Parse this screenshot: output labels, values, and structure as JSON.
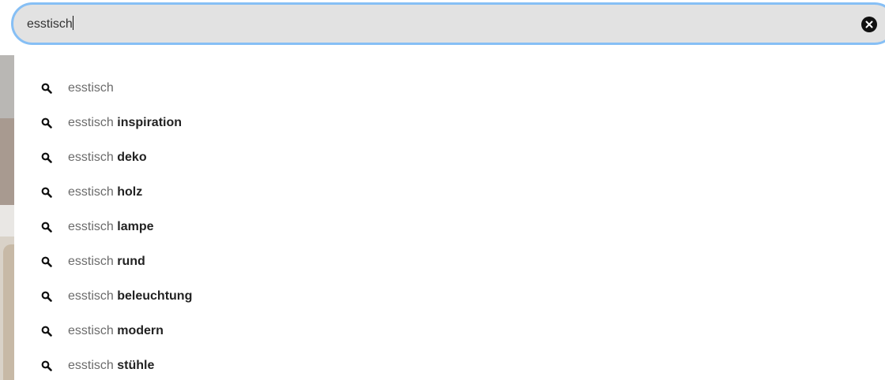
{
  "search": {
    "value": "esstisch",
    "clear_icon": "close-circle-icon"
  },
  "colors": {
    "search_border": "#86bff5",
    "search_background": "#e2e2e2",
    "query_text": "#6b6b6b",
    "completion_text": "#222222"
  },
  "suggestions": [
    {
      "icon": "search-icon",
      "query": "esstisch",
      "completion": ""
    },
    {
      "icon": "search-icon",
      "query": "esstisch",
      "completion": " inspiration"
    },
    {
      "icon": "search-icon",
      "query": "esstisch",
      "completion": " deko"
    },
    {
      "icon": "search-icon",
      "query": "esstisch",
      "completion": " holz"
    },
    {
      "icon": "search-icon",
      "query": "esstisch",
      "completion": " lampe"
    },
    {
      "icon": "search-icon",
      "query": "esstisch",
      "completion": " rund"
    },
    {
      "icon": "search-icon",
      "query": "esstisch",
      "completion": " beleuchtung"
    },
    {
      "icon": "search-icon",
      "query": "esstisch",
      "completion": " modern"
    },
    {
      "icon": "search-icon",
      "query": "esstisch",
      "completion": " stühle"
    }
  ]
}
